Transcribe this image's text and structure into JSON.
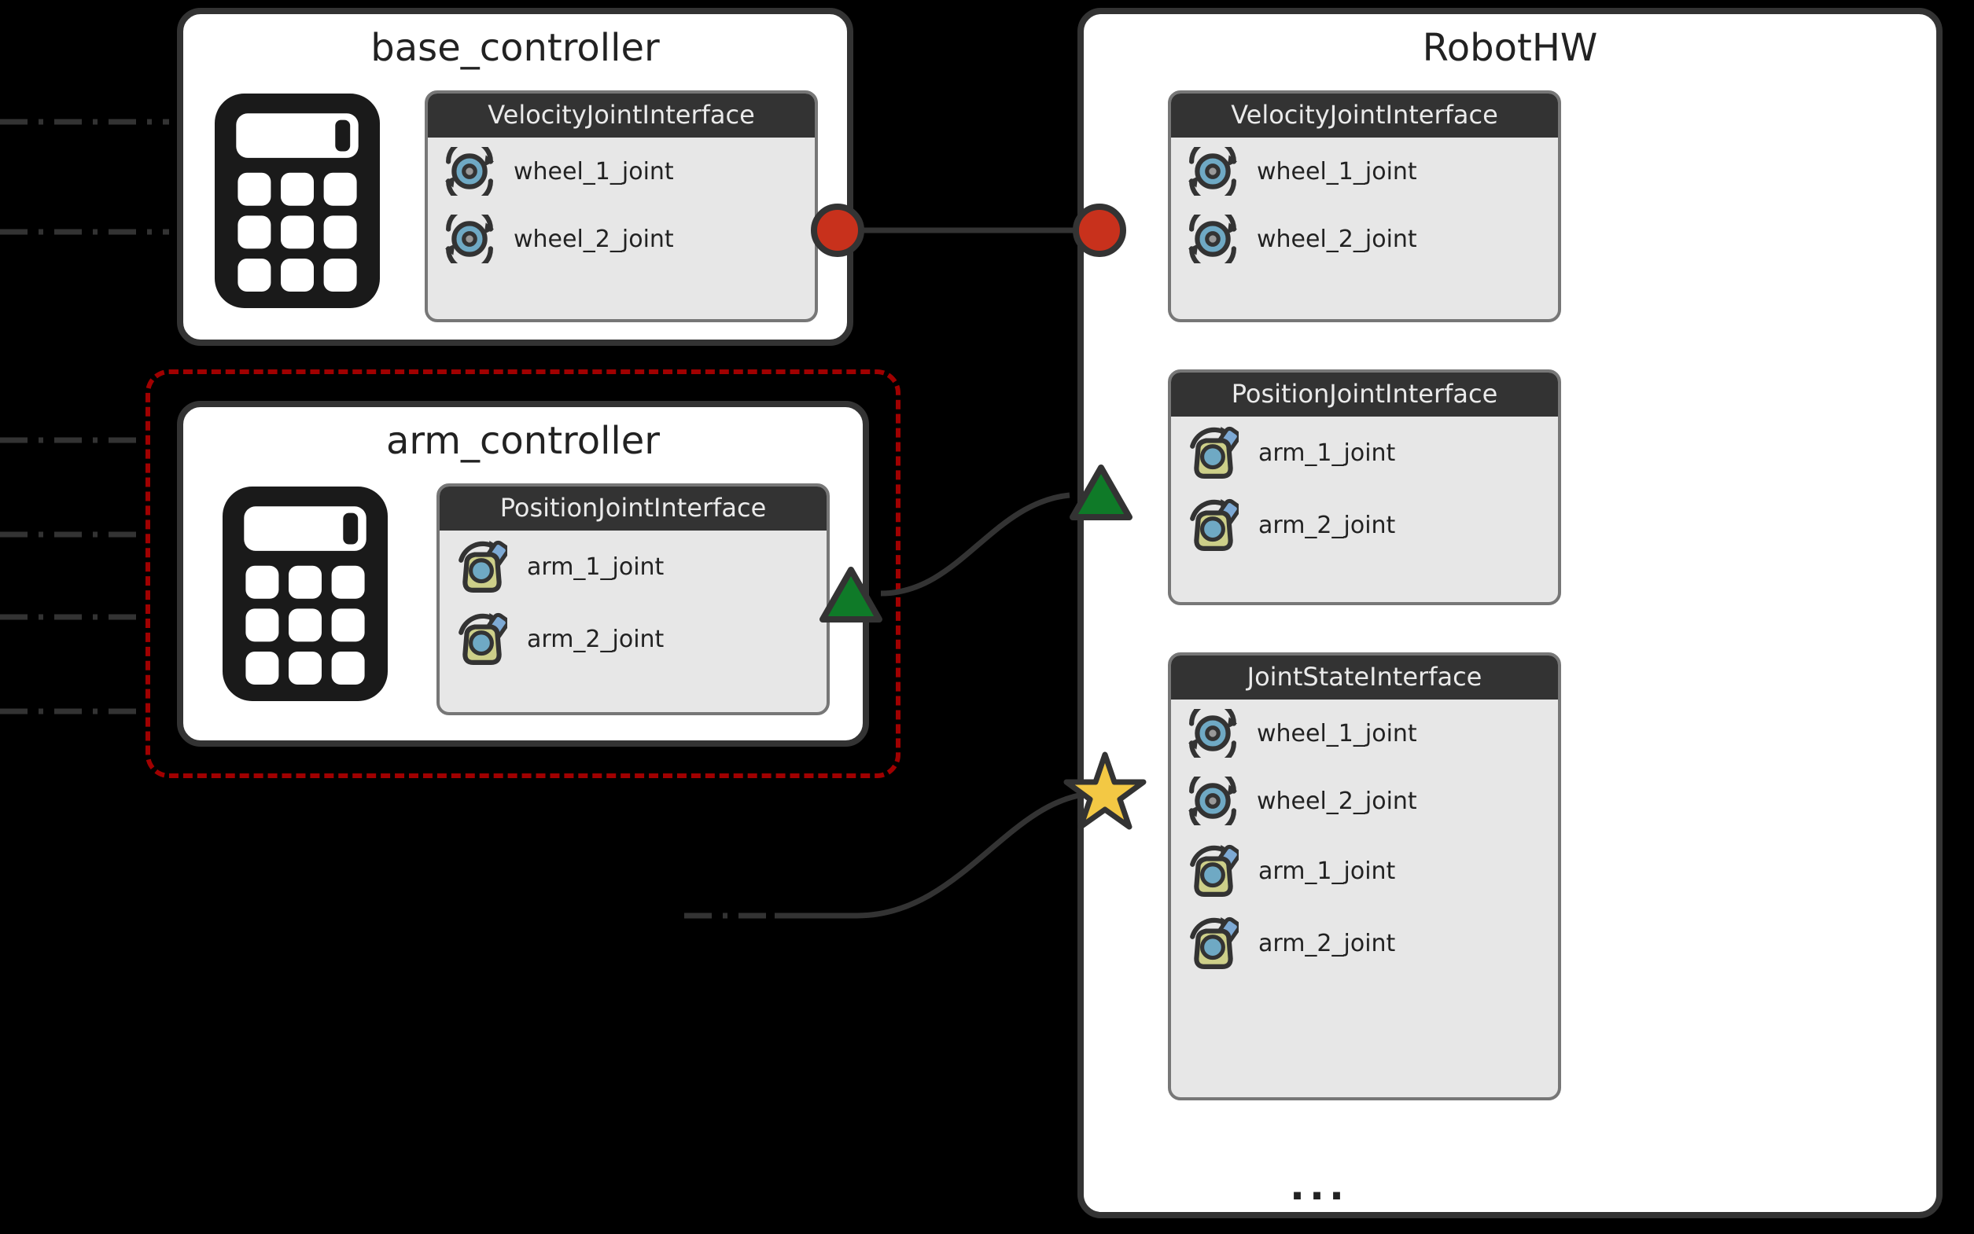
{
  "controllers": {
    "base": {
      "title": "base_controller",
      "interface": {
        "name": "VelocityJointInterface",
        "joints": [
          "wheel_1_joint",
          "wheel_2_joint"
        ]
      }
    },
    "arm": {
      "title": "arm_controller",
      "interface": {
        "name": "PositionJointInterface",
        "joints": [
          "arm_1_joint",
          "arm_2_joint"
        ]
      }
    }
  },
  "robot_hw": {
    "title": "RobotHW",
    "interfaces": [
      {
        "name": "VelocityJointInterface",
        "joints": [
          "wheel_1_joint",
          "wheel_2_joint"
        ],
        "joint_type": "wheel"
      },
      {
        "name": "PositionJointInterface",
        "joints": [
          "arm_1_joint",
          "arm_2_joint"
        ],
        "joint_type": "arm"
      },
      {
        "name": "JointStateInterface",
        "joints": [
          "wheel_1_joint",
          "wheel_2_joint",
          "arm_1_joint",
          "arm_2_joint"
        ],
        "joint_type": "mixed"
      }
    ]
  },
  "ellipsis": "..."
}
